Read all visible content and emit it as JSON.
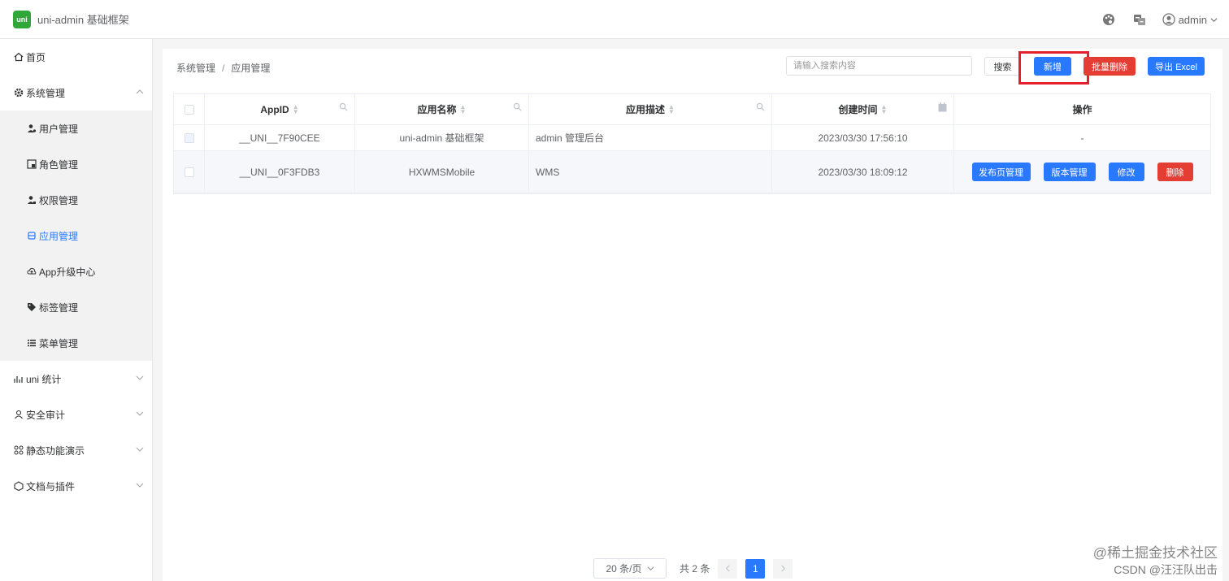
{
  "app": {
    "logo_text": "uni",
    "title": "uni-admin 基础框架"
  },
  "header": {
    "user": "admin"
  },
  "sidebar": {
    "items": [
      {
        "label": "首页"
      },
      {
        "label": "系统管理"
      },
      {
        "label": "uni 统计"
      },
      {
        "label": "安全审计"
      },
      {
        "label": "静态功能演示"
      },
      {
        "label": "文档与插件"
      }
    ],
    "sub_items": [
      {
        "label": "用户管理"
      },
      {
        "label": "角色管理"
      },
      {
        "label": "权限管理"
      },
      {
        "label": "应用管理"
      },
      {
        "label": "App升级中心"
      },
      {
        "label": "标签管理"
      },
      {
        "label": "菜单管理"
      }
    ]
  },
  "breadcrumb": {
    "parent": "系统管理",
    "separator": "/",
    "current": "应用管理"
  },
  "toolbar": {
    "search_placeholder": "请输入搜索内容",
    "search_label": "搜索",
    "add_label": "新增",
    "batch_delete_label": "批量删除",
    "export_label": "导出 Excel"
  },
  "table": {
    "columns": [
      "AppID",
      "应用名称",
      "应用描述",
      "创建时间",
      "操作"
    ],
    "rows": [
      {
        "appid": "__UNI__7F90CEE",
        "name": "uni-admin 基础框架",
        "desc": "admin 管理后台",
        "time": "2023/03/30 17:56:10",
        "action": "-"
      },
      {
        "appid": "__UNI__0F3FDB3",
        "name": "HXWMSMobile",
        "desc": "WMS",
        "time": "2023/03/30 18:09:12"
      }
    ],
    "row_actions": [
      "发布页管理",
      "版本管理",
      "修改",
      "删除"
    ]
  },
  "pagination": {
    "page_size": "20 条/页",
    "total": "共 2 条",
    "current": "1"
  },
  "watermark": {
    "line1": "@稀土掘金技术社区",
    "line2": "CSDN @汪汪队出击"
  },
  "colors": {
    "primary": "#2979ff",
    "danger": "#e43d33",
    "highlight": "#e3202b",
    "logo": "#2fa838"
  }
}
